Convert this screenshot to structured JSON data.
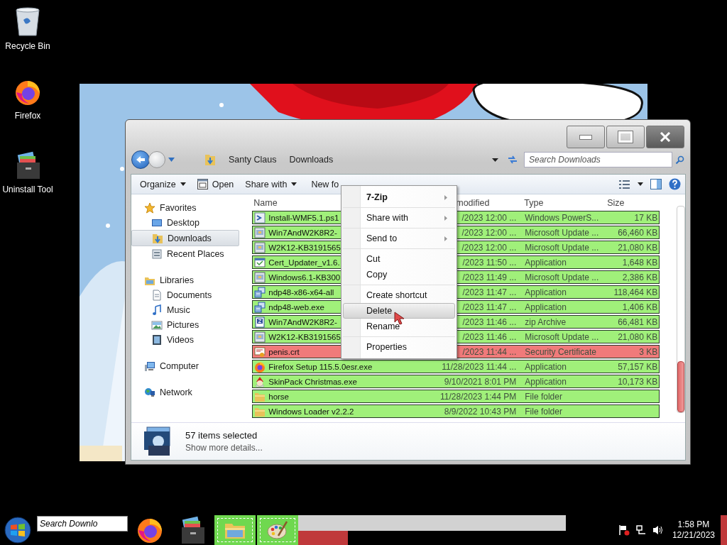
{
  "desktop_icons": [
    {
      "label": "Recycle Bin",
      "kind": "recycle"
    },
    {
      "label": "Firefox",
      "kind": "firefox"
    },
    {
      "label": "Uninstall Tool",
      "kind": "uninstall"
    }
  ],
  "explorer": {
    "breadcrumb": [
      "Santy Claus",
      "Downloads"
    ],
    "search": {
      "placeholder": "Search Downloads"
    },
    "toolbar": [
      {
        "label": "Organize",
        "kind": "dropdown"
      },
      {
        "label": "Open",
        "kind": "icon"
      },
      {
        "label": "Share with",
        "kind": "dropdown"
      },
      {
        "label": "New fo",
        "kind": "plain"
      }
    ],
    "sidebar": [
      {
        "label": "Favorites",
        "kind": "star",
        "selected": false,
        "children": [
          {
            "label": "Desktop",
            "kind": "desktop",
            "selected": false
          },
          {
            "label": "Downloads",
            "kind": "downloads",
            "selected": true
          },
          {
            "label": "Recent Places",
            "kind": "recent",
            "selected": false
          }
        ]
      },
      {
        "label": "Libraries",
        "kind": "library",
        "selected": false,
        "children": [
          {
            "label": "Documents",
            "kind": "document",
            "selected": false
          },
          {
            "label": "Music",
            "kind": "music",
            "selected": false
          },
          {
            "label": "Pictures",
            "kind": "pictures",
            "selected": false
          },
          {
            "label": "Videos",
            "kind": "videos",
            "selected": false
          }
        ]
      },
      {
        "label": "Computer",
        "kind": "computer",
        "selected": false
      },
      {
        "label": "Network",
        "kind": "network",
        "selected": false
      }
    ],
    "columns": [
      "Name",
      "modified",
      "Type",
      "Size"
    ],
    "rows": [
      {
        "name": "Install-WMF5.1.ps1",
        "date": "/2023 12:00 ...",
        "type": "Windows PowerS...",
        "size": "17 KB",
        "kind": "script",
        "color": "#a0f07a",
        "selected": true
      },
      {
        "name": "Win7AndW2K8R2-",
        "date": "/2023 12:00 ...",
        "type": "Microsoft Update ...",
        "size": "66,460 KB",
        "kind": "package",
        "color": "#a0f07a",
        "selected": true
      },
      {
        "name": "W2K12-KB3191565",
        "date": "/2023 12:00 ...",
        "type": "Microsoft Update ...",
        "size": "21,080 KB",
        "kind": "package",
        "color": "#a0f07a",
        "selected": true
      },
      {
        "name": "Cert_Updater_v1.6.",
        "date": "/2023 11:50 ...",
        "type": "Application",
        "size": "1,648 KB",
        "kind": "app",
        "color": "#a0f07a",
        "selected": true
      },
      {
        "name": "Windows6.1-KB300",
        "date": "/2023 11:49 ...",
        "type": "Microsoft Update ...",
        "size": "2,386 KB",
        "kind": "package",
        "color": "#a0f07a",
        "selected": true
      },
      {
        "name": "ndp48-x86-x64-all",
        "date": "/2023 11:47 ...",
        "type": "Application",
        "size": "118,464 KB",
        "kind": "installer",
        "color": "#a0f07a",
        "selected": true
      },
      {
        "name": "ndp48-web.exe",
        "date": "/2023 11:47 ...",
        "type": "Application",
        "size": "1,406 KB",
        "kind": "installer",
        "color": "#a0f07a",
        "selected": true
      },
      {
        "name": "Win7AndW2K8R2-",
        "date": "/2023 11:46 ...",
        "type": "zip Archive",
        "size": "66,481 KB",
        "kind": "zip",
        "color": "#a0f07a",
        "selected": true
      },
      {
        "name": "W2K12-KB3191565",
        "date": "/2023 11:46 ...",
        "type": "Microsoft Update ...",
        "size": "21,080 KB",
        "kind": "package",
        "color": "#a0f07a",
        "selected": true
      },
      {
        "name": "penis.crt",
        "date": "/2023 11:44 ...",
        "type": "Security Certificate",
        "size": "3 KB",
        "kind": "certificate",
        "color": "#f07a7a",
        "selected": true
      },
      {
        "name": "Firefox Setup 115.5.0esr.exe",
        "date": "11/28/2023 11:44 ...",
        "type": "Application",
        "size": "57,157 KB",
        "kind": "firefox",
        "color": "#a0f07a",
        "selected": true
      },
      {
        "name": "SkinPack Christmas.exe",
        "date": "9/10/2021 8:01 PM",
        "type": "Application",
        "size": "10,173 KB",
        "kind": "skinpack",
        "color": "#a0f07a",
        "selected": true
      },
      {
        "name": "horse",
        "date": "11/28/2023 1:44 PM",
        "type": "File folder",
        "kind": "folder",
        "color": "#a0f07a",
        "selected": true
      },
      {
        "name": "Windows Loader v2.2.2",
        "date": "8/9/2022 10:43 PM",
        "type": "File folder",
        "kind": "folder",
        "color": "#a0f07a",
        "selected": true
      }
    ],
    "details": {
      "title": "57 items selected",
      "link": "Show more details..."
    }
  },
  "context_menu": {
    "sections": [
      [
        {
          "label": "7-Zip",
          "bold": true,
          "submenu": true,
          "selected": false
        }
      ],
      [
        {
          "label": "Share with",
          "bold": false,
          "submenu": true,
          "selected": false
        }
      ],
      [
        {
          "label": "Send to",
          "bold": false,
          "submenu": true,
          "selected": false
        }
      ],
      [
        {
          "label": "Cut",
          "bold": false,
          "submenu": false,
          "selected": false
        },
        {
          "label": "Copy",
          "bold": false,
          "submenu": false,
          "selected": false
        }
      ],
      [
        {
          "label": "Create shortcut",
          "bold": false,
          "submenu": false,
          "selected": false
        },
        {
          "label": "Delete",
          "bold": false,
          "submenu": false,
          "selected": true
        },
        {
          "label": "Rename",
          "bold": false,
          "submenu": false,
          "selected": false
        }
      ],
      [
        {
          "label": "Properties",
          "bold": false,
          "submenu": false,
          "selected": false
        }
      ]
    ]
  },
  "taskbar": {
    "search_value": "Search Downlo",
    "buttons": [
      {
        "kind": "firefox",
        "active": false
      },
      {
        "kind": "uninstall",
        "active": false
      },
      {
        "kind": "explorer",
        "active": true
      },
      {
        "kind": "paint",
        "active": true
      }
    ],
    "clock": {
      "time": "1:58 PM",
      "date": "12/21/2023"
    }
  }
}
